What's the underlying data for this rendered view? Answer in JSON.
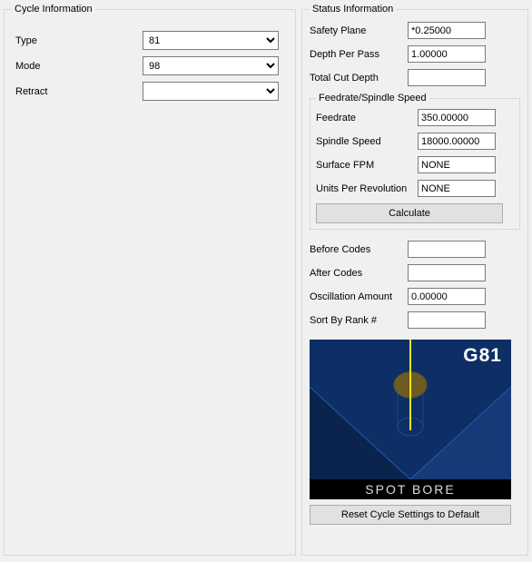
{
  "cycle_info": {
    "legend": "Cycle Information",
    "type_label": "Type",
    "type_value": "81",
    "mode_label": "Mode",
    "mode_value": "98",
    "retract_label": "Retract",
    "retract_value": ""
  },
  "status_info": {
    "legend": "Status Information",
    "safety_plane_label": "Safety Plane",
    "safety_plane_value": "*0.25000",
    "depth_per_pass_label": "Depth Per Pass",
    "depth_per_pass_value": "1.00000",
    "total_cut_depth_label": "Total Cut Depth",
    "total_cut_depth_value": ""
  },
  "feedrate_spindle": {
    "legend": "Feedrate/Spindle Speed",
    "feedrate_label": "Feedrate",
    "feedrate_value": "350.00000",
    "spindle_speed_label": "Spindle Speed",
    "spindle_speed_value": "18000.00000",
    "surface_fpm_label": "Surface FPM",
    "surface_fpm_value": "NONE",
    "units_per_rev_label": "Units Per Revolution",
    "units_per_rev_value": "NONE",
    "calculate_label": "Calculate"
  },
  "misc": {
    "before_codes_label": "Before Codes",
    "before_codes_value": "",
    "after_codes_label": "After Codes",
    "after_codes_value": "",
    "oscillation_label": "Oscillation Amount",
    "oscillation_value": "0.00000",
    "sort_rank_label": "Sort By Rank #",
    "sort_rank_value": ""
  },
  "preview": {
    "badge": "G81",
    "caption": "SPOT BORE"
  },
  "reset_label": "Reset Cycle Settings to Default"
}
